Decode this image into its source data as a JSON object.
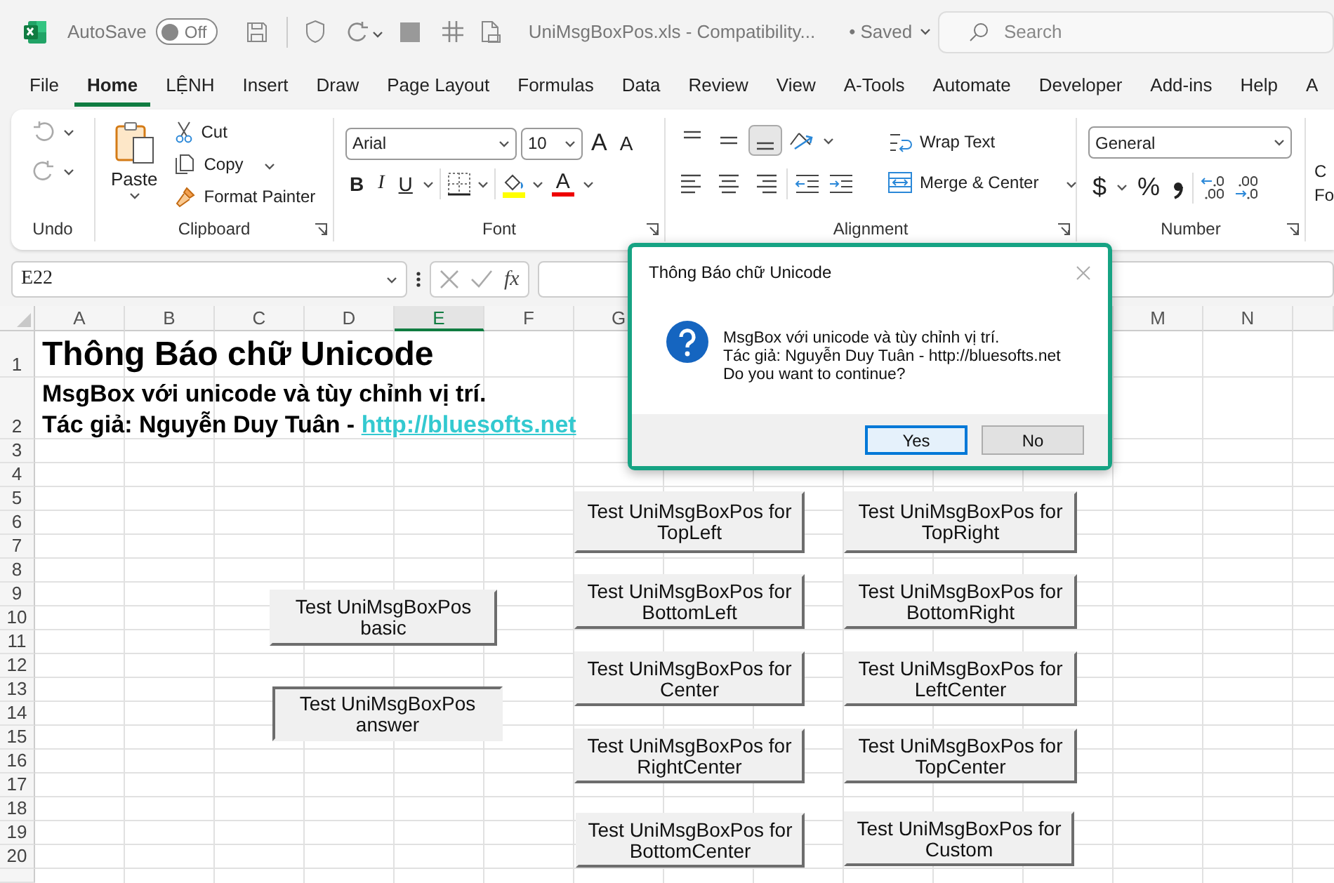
{
  "title_bar": {
    "autosave_label": "AutoSave",
    "autosave_toggle": {
      "label": "Off",
      "on": false
    },
    "filename": "UniMsgBoxPos.xls  -  Compatibility...",
    "save_status": "• Saved",
    "search": {
      "placeholder": "Search"
    }
  },
  "ribbon_tabs": [
    {
      "label": "File",
      "selected": false
    },
    {
      "label": "Home",
      "selected": true
    },
    {
      "label": "LỆNH",
      "selected": false
    },
    {
      "label": "Insert",
      "selected": false
    },
    {
      "label": "Draw",
      "selected": false
    },
    {
      "label": "Page Layout",
      "selected": false
    },
    {
      "label": "Formulas",
      "selected": false
    },
    {
      "label": "Data",
      "selected": false
    },
    {
      "label": "Review",
      "selected": false
    },
    {
      "label": "View",
      "selected": false
    },
    {
      "label": "A-Tools",
      "selected": false
    },
    {
      "label": "Automate",
      "selected": false
    },
    {
      "label": "Developer",
      "selected": false
    },
    {
      "label": "Add-ins",
      "selected": false
    },
    {
      "label": "Help",
      "selected": false
    },
    {
      "label": "A",
      "selected": false
    }
  ],
  "ribbon": {
    "undo": {
      "label": "Undo"
    },
    "clipboard": {
      "label": "Clipboard",
      "paste": "Paste",
      "cut": "Cut",
      "copy": "Copy",
      "format_painter": "Format Painter"
    },
    "font": {
      "label": "Font",
      "font_name": "Arial",
      "font_size": "10",
      "grow_font": "A",
      "shrink_font": "A",
      "bold": "B",
      "italic": "I",
      "underline": "U",
      "font_color": "A"
    },
    "alignment": {
      "label": "Alignment",
      "bottom_align_selected": true,
      "wrap_text": "Wrap Text",
      "merge_center": "Merge & Center"
    },
    "number": {
      "label": "Number",
      "format": "General",
      "currency": "$",
      "percent": "%"
    },
    "cut_group": {
      "line_1": "C",
      "line_2": "Fo"
    }
  },
  "formula_bar": {
    "name_box": "E22",
    "function_label": "fx"
  },
  "sheet": {
    "columns": [
      {
        "label": "A",
        "selected": false
      },
      {
        "label": "B",
        "selected": false
      },
      {
        "label": "C",
        "selected": false
      },
      {
        "label": "D",
        "selected": false
      },
      {
        "label": "E",
        "selected": true
      },
      {
        "label": "F",
        "selected": false
      },
      {
        "label": "G",
        "selected": false
      },
      {
        "label": "M",
        "selected": false
      },
      {
        "label": "N",
        "selected": false
      }
    ],
    "rows": [
      "1",
      "2",
      "3",
      "4",
      "5",
      "6",
      "7",
      "8",
      "9",
      "10",
      "11",
      "12",
      "13",
      "14",
      "15",
      "16",
      "17",
      "18",
      "19",
      "20"
    ],
    "title": "Thông Báo chữ Unicode",
    "subtitle": "MsgBox với unicode và tùy chỉnh vị trí.",
    "author": "Tác giả: Nguyễn Duy Tuân - ",
    "link": "http://bluesofts.net",
    "buttons": [
      {
        "label": "Test UniMsgBoxPos basic",
        "pressed": false
      },
      {
        "label": "Test UniMsgBoxPos answer",
        "pressed": true
      },
      {
        "label": "Test UniMsgBoxPos for TopLeft",
        "pressed": false
      },
      {
        "label": "Test UniMsgBoxPos for TopRight",
        "pressed": false
      },
      {
        "label": "Test UniMsgBoxPos for BottomLeft",
        "pressed": false
      },
      {
        "label": "Test UniMsgBoxPos for BottomRight",
        "pressed": false
      },
      {
        "label": "Test UniMsgBoxPos for Center",
        "pressed": false
      },
      {
        "label": "Test UniMsgBoxPos for LeftCenter",
        "pressed": false
      },
      {
        "label": "Test UniMsgBoxPos for RightCenter",
        "pressed": false
      },
      {
        "label": "Test UniMsgBoxPos for TopCenter",
        "pressed": false
      },
      {
        "label": "Test UniMsgBoxPos for BottomCenter",
        "pressed": false
      },
      {
        "label": "Test UniMsgBoxPos for Custom",
        "pressed": false
      }
    ]
  },
  "dialog": {
    "title": "Thông Báo chữ Unicode",
    "message": [
      "MsgBox với unicode và tùy chỉnh vị trí.",
      "Tác giả: Nguyễn Duy Tuân - http://bluesofts.net",
      "Do you want to continue?"
    ],
    "buttons": [
      {
        "label": "Yes",
        "selected": true
      },
      {
        "label": "No",
        "selected": false
      }
    ]
  }
}
